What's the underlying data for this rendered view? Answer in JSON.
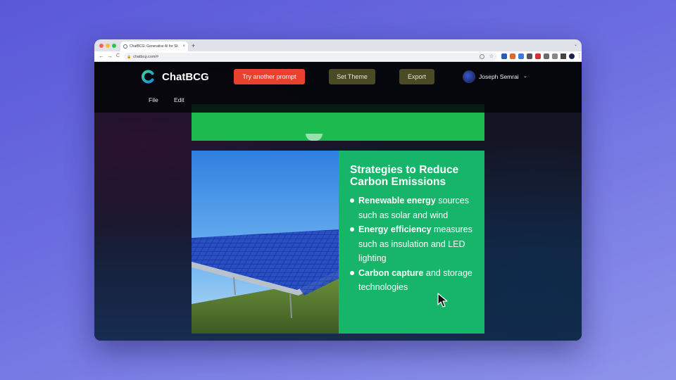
{
  "browser": {
    "tab_title": "ChatBCG: Generative AI for Sli",
    "tab_close": "×",
    "new_tab": "+",
    "url": "chatbcg.com/#",
    "back": "←",
    "forward": "→",
    "reload": "C",
    "tab_menu": "⌄"
  },
  "app": {
    "name": "ChatBCG",
    "buttons": {
      "try_another": "Try another prompt",
      "set_theme": "Set Theme",
      "export": "Export"
    },
    "user": {
      "name": "Joseph Semrai",
      "chevron": "⌄"
    },
    "menu": {
      "file": "File",
      "edit": "Edit"
    }
  },
  "slide": {
    "heading": "Strategies to Reduce Carbon Emissions",
    "bullets": [
      {
        "bold": "Renewable energy",
        "rest": " sources such as solar and wind"
      },
      {
        "bold": "Energy efficiency",
        "rest": " measures such as insulation and LED lighting"
      },
      {
        "bold": "Carbon capture",
        "rest": " and storage technologies"
      }
    ]
  },
  "colors": {
    "primary_button": "#e8422f",
    "slide_green": "#16b569",
    "top_slide_green": "#1dbb4f",
    "secondary_button": "#4a4a24"
  },
  "icons": {
    "logo": "chatbcg-logo-icon",
    "cursor": "mouse-pointer-icon",
    "image": "solar-panel-photo"
  }
}
